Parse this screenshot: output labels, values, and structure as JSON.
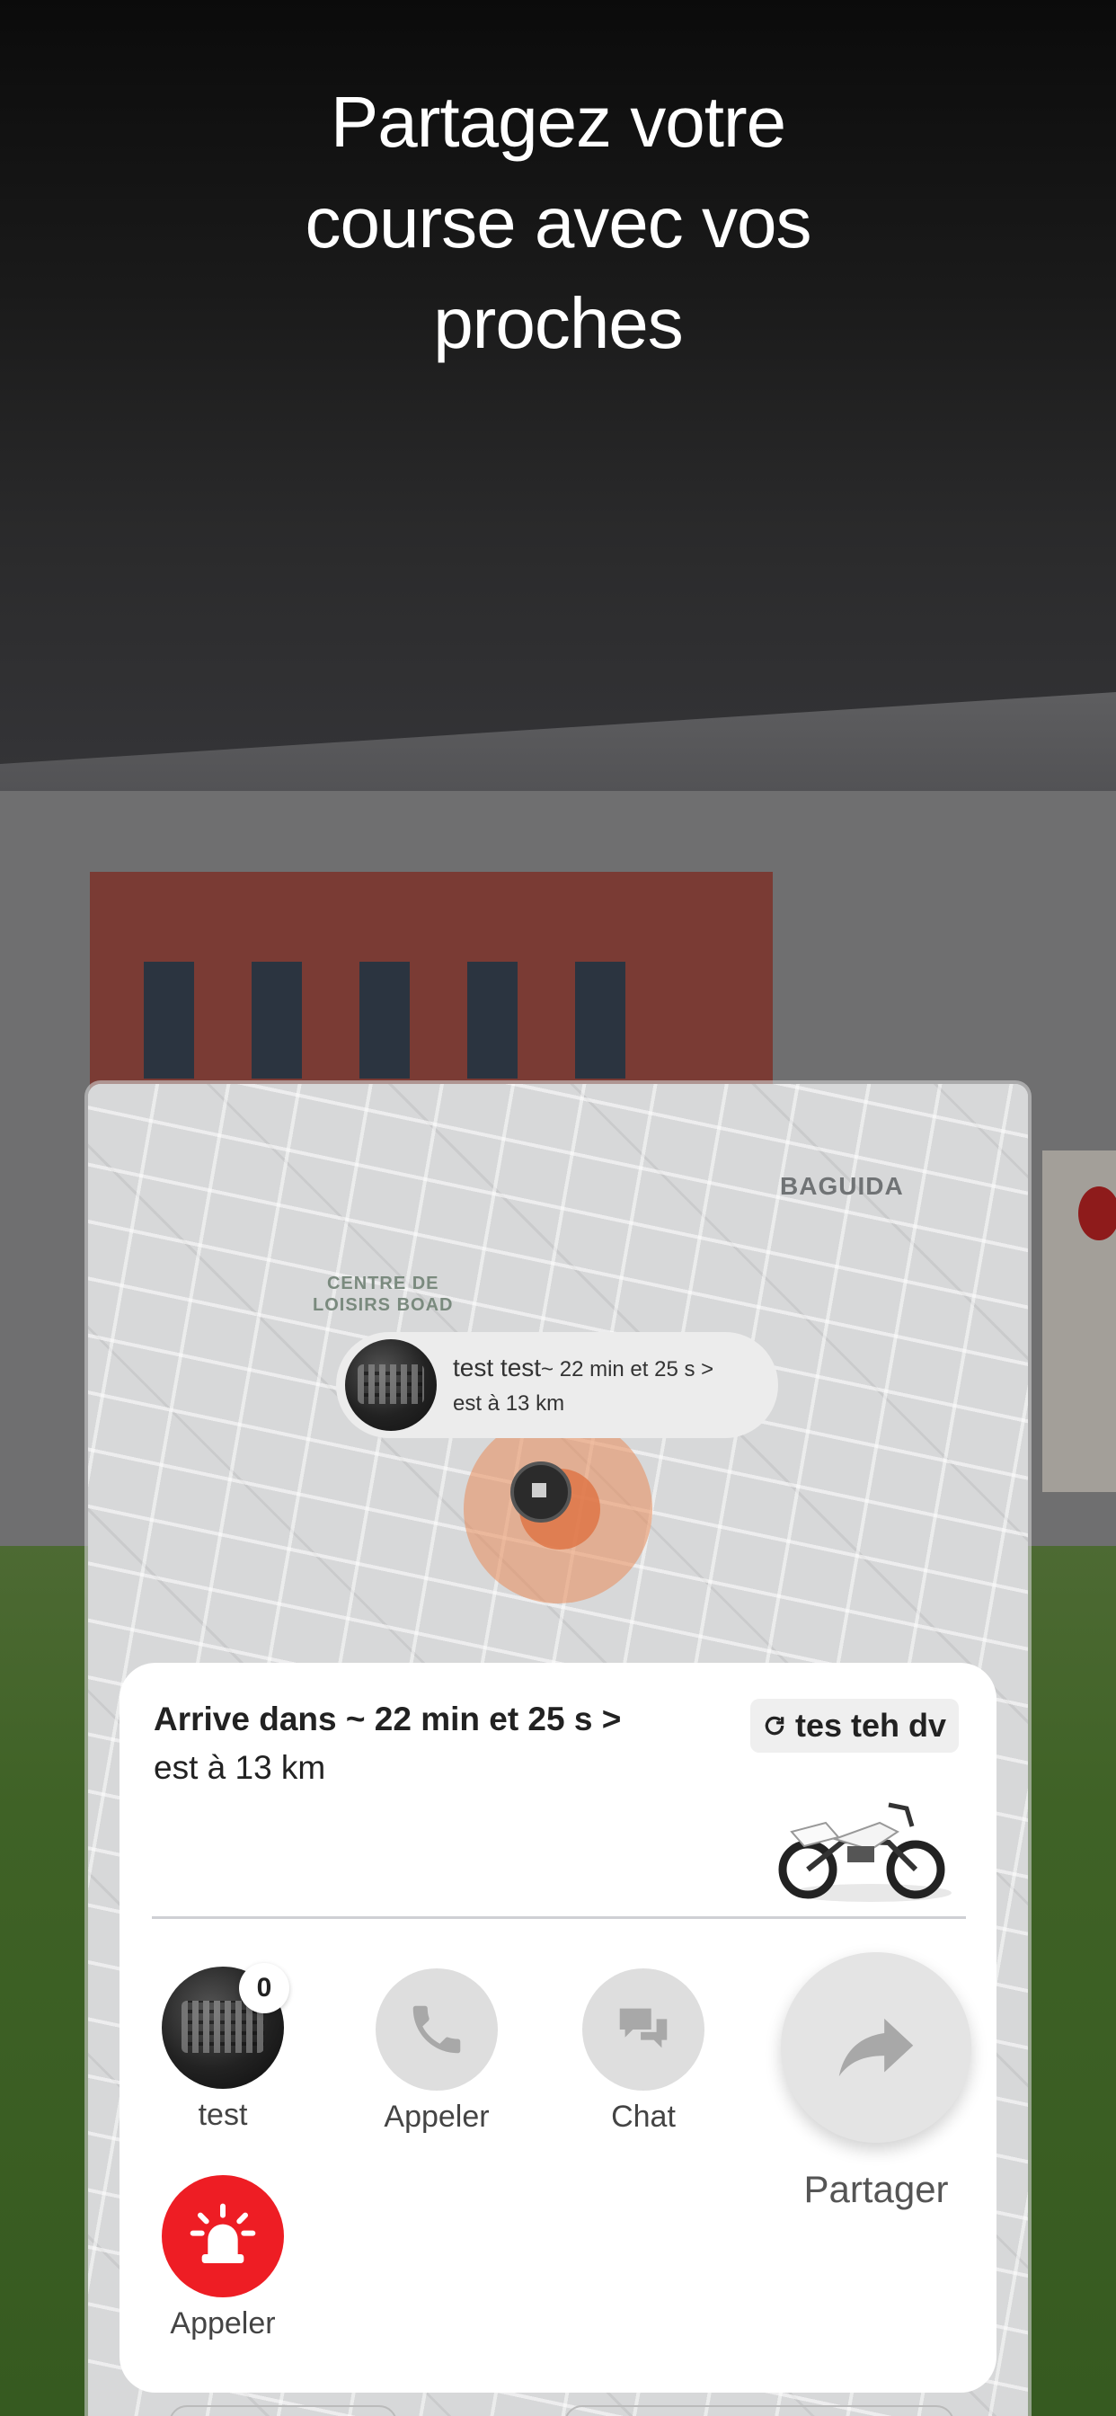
{
  "headline": {
    "line1": "Partagez votre",
    "line2": "course avec vos",
    "line3": "proches"
  },
  "map": {
    "area_label": "BAGUIDA",
    "poi_line1": "CENTRE DE",
    "poi_line2": "LOISIRS BOAD",
    "callout": {
      "name": "test test",
      "eta": "~ 22 min et 25 s >",
      "distance": "est à 13 km"
    }
  },
  "trip_card": {
    "arrival": "Arrive dans ~ 22 min et 25 s >",
    "distance": "est à 13 km",
    "vehicle_plate": "tes teh dv"
  },
  "actions": {
    "driver_name": "test",
    "unread_count": "0",
    "call_label": "Appeler",
    "chat_label": "Chat",
    "share_label": "Partager",
    "emergency_label": "Appeler"
  },
  "colors": {
    "emergency": "#ee1d24",
    "pulse": "#e98c5a"
  }
}
